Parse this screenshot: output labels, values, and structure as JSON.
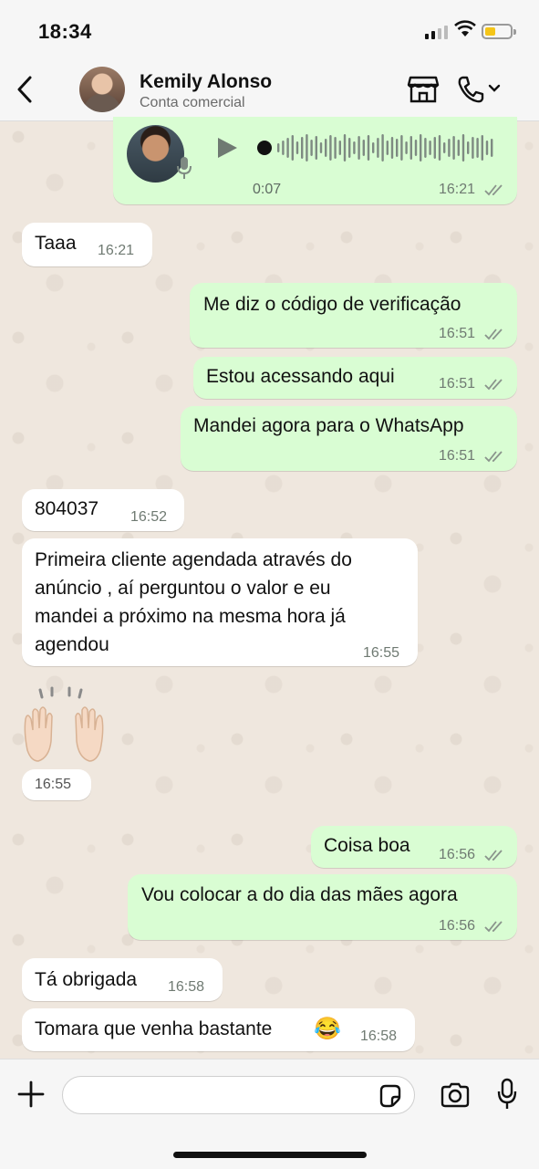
{
  "status_bar": {
    "time": "18:34"
  },
  "header": {
    "name": "Kemily Alonso",
    "subtitle": "Conta comercial"
  },
  "audio_message": {
    "duration": "0:07",
    "time": "16:21"
  },
  "messages": [
    {
      "dir": "in",
      "text": "Taaa",
      "time": "16:21"
    },
    {
      "dir": "out",
      "text": "Me diz o código de verificação",
      "time": "16:51"
    },
    {
      "dir": "out",
      "text": "Estou acessando aqui",
      "time": "16:51"
    },
    {
      "dir": "out",
      "text": "Mandei agora para o WhatsApp",
      "time": "16:51"
    },
    {
      "dir": "in",
      "text": "804037",
      "time": "16:52"
    },
    {
      "dir": "in",
      "lines": [
        "Primeira cliente agendada através do",
        "anúncio , aí perguntou o valor e eu",
        "mandei a próximo na mesma hora já",
        "agendou"
      ],
      "time": "16:55"
    },
    {
      "dir": "in",
      "emoji": "raising-hands",
      "time": "16:55"
    },
    {
      "dir": "out",
      "text": "Coisa boa",
      "time": "16:56"
    },
    {
      "dir": "out",
      "text": "Vou colocar a do dia das mães agora",
      "time": "16:56"
    },
    {
      "dir": "in",
      "text": "Tá obrigada",
      "time": "16:58"
    },
    {
      "dir": "in",
      "text": "Tomara que venha bastante",
      "emoji": "😂",
      "time": "16:58"
    }
  ],
  "composer": {
    "placeholder": ""
  },
  "colors": {
    "incoming": "#ffffff",
    "outgoing": "#d9fdd3",
    "tick": "#8a948c",
    "wallpaper": "#efe7de"
  }
}
